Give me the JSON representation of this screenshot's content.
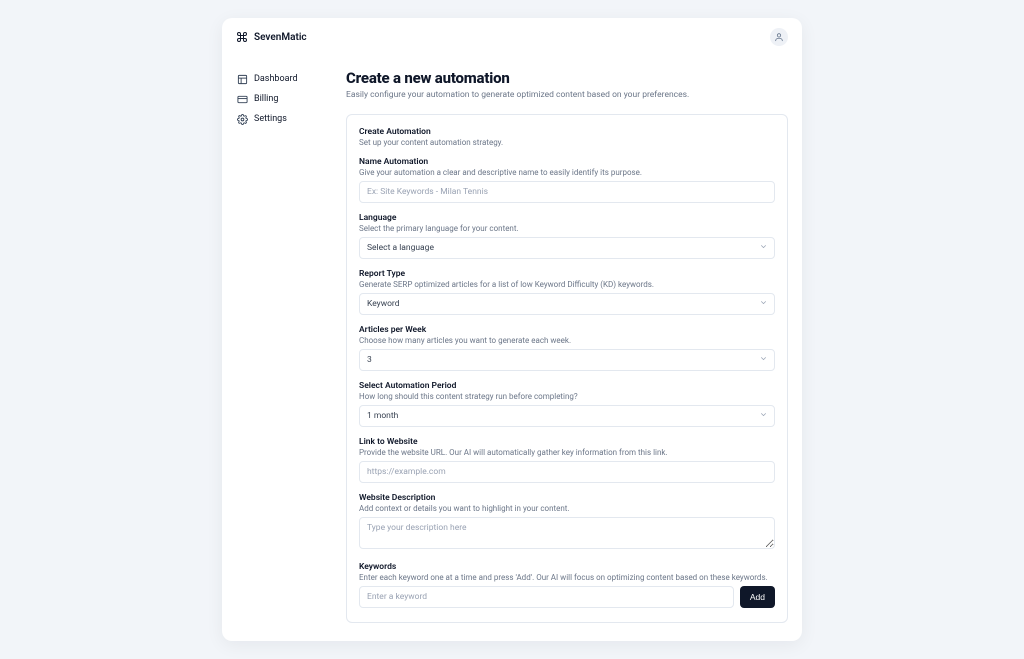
{
  "brand": "SevenMatic",
  "sidebar": {
    "items": [
      {
        "label": "Dashboard"
      },
      {
        "label": "Billing"
      },
      {
        "label": "Settings"
      }
    ]
  },
  "page": {
    "title": "Create a new automation",
    "subtitle": "Easily configure your automation to generate optimized content based on your preferences."
  },
  "form": {
    "section": {
      "title": "Create Automation",
      "help": "Set up your content automation strategy."
    },
    "name": {
      "label": "Name Automation",
      "help": "Give your automation a clear and descriptive name to easily identify its purpose.",
      "placeholder": "Ex: Site Keywords - Milan Tennis"
    },
    "language": {
      "label": "Language",
      "help": "Select the primary language for your content.",
      "value": "Select a language"
    },
    "report_type": {
      "label": "Report Type",
      "help": "Generate SERP optimized articles for a list of low Keyword Difficulty (KD) keywords.",
      "value": "Keyword"
    },
    "articles": {
      "label": "Articles per Week",
      "help": "Choose how many articles you want to generate each week.",
      "value": "3"
    },
    "period": {
      "label": "Select Automation Period",
      "help": "How long should this content strategy run before completing?",
      "value": "1 month"
    },
    "link": {
      "label": "Link to Website",
      "help": "Provide the website URL. Our AI will automatically gather key information from this link.",
      "placeholder": "https://example.com"
    },
    "description": {
      "label": "Website Description",
      "help": "Add context or details you want to highlight in your content.",
      "placeholder": "Type your description here"
    },
    "keywords": {
      "label": "Keywords",
      "help": "Enter each keyword one at a time and press 'Add'. Our AI will focus on optimizing content based on these keywords.",
      "placeholder": "Enter a keyword",
      "add_label": "Add"
    }
  }
}
